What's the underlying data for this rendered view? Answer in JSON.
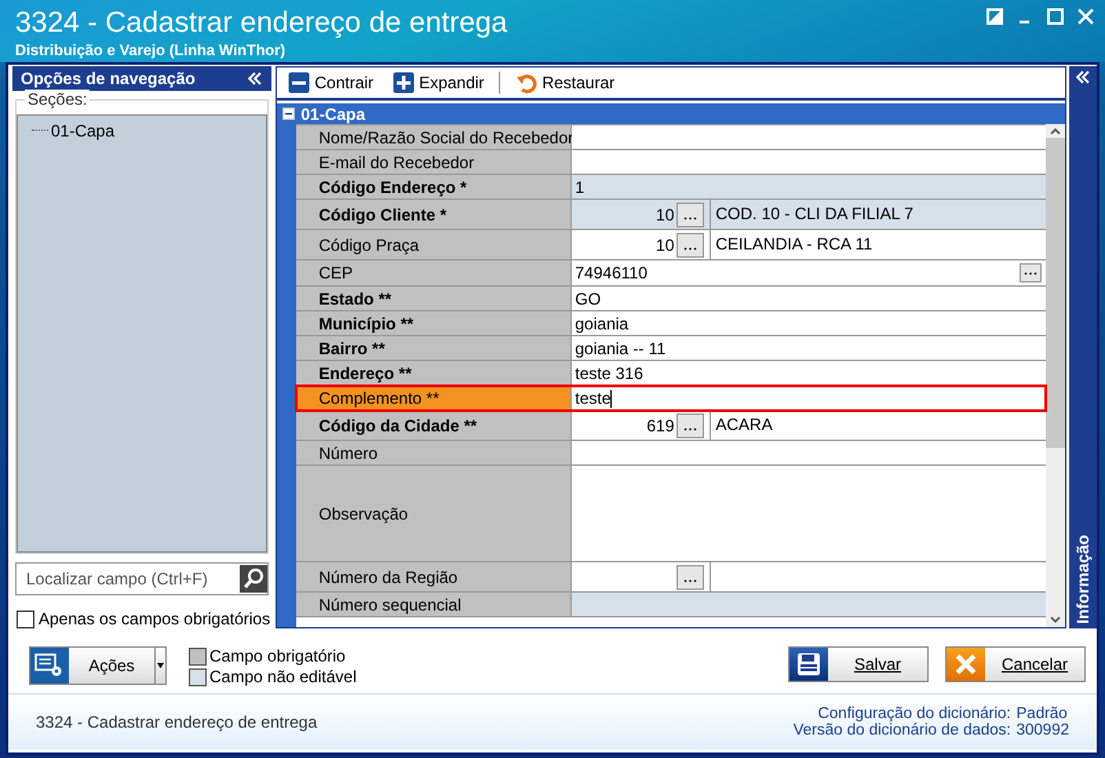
{
  "window": {
    "title": "3324 - Cadastrar endereço de entrega",
    "subtitle": "Distribuição e Varejo (Linha WinThor)"
  },
  "navigation": {
    "title": "Opções de navegação",
    "sections_label": "Seções:",
    "tree": [
      {
        "label": "01-Capa"
      }
    ],
    "search": {
      "placeholder": "Localizar campo (Ctrl+F)"
    },
    "required_only": {
      "label": "Apenas os campos obrigatórios",
      "checked": false
    }
  },
  "toolbar": [
    {
      "label": "Contrair",
      "kind": "collapse"
    },
    {
      "label": "Expandir",
      "kind": "expand"
    },
    {
      "label": "Restaurar",
      "kind": "restore"
    }
  ],
  "section": {
    "title": "01-Capa",
    "expanded": true
  },
  "rows": [
    {
      "label": "Nome/Razão Social do Recebedor",
      "bold": false,
      "kind": "text",
      "value": "",
      "readonly": false,
      "selected": false
    },
    {
      "label": "E-mail do Recebedor",
      "bold": false,
      "kind": "text",
      "value": "",
      "readonly": false,
      "selected": false
    },
    {
      "label": "Código Endereço *",
      "bold": true,
      "kind": "text",
      "value": "1",
      "readonly": true,
      "selected": false
    },
    {
      "label": "Código Cliente  *",
      "bold": true,
      "kind": "lookup",
      "value": "10",
      "description": "COD. 10 - CLI DA FILIAL 7",
      "readonly": true,
      "selected": false
    },
    {
      "label": "Código Praça",
      "bold": false,
      "kind": "lookup",
      "value": "10",
      "description": "CEILANDIA - RCA 11",
      "readonly": false,
      "selected": false
    },
    {
      "label": "CEP",
      "bold": false,
      "kind": "search",
      "value": "74946110",
      "readonly": false,
      "selected": false
    },
    {
      "label": "Estado **",
      "bold": true,
      "kind": "text",
      "value": "GO",
      "readonly": false,
      "selected": false
    },
    {
      "label": "Município **",
      "bold": true,
      "kind": "text",
      "value": "goiania",
      "readonly": false,
      "selected": false
    },
    {
      "label": "Bairro **",
      "bold": true,
      "kind": "text",
      "value": "goiania -- 11",
      "readonly": false,
      "selected": false
    },
    {
      "label": "Endereço **",
      "bold": true,
      "kind": "text",
      "value": "teste 316",
      "readonly": false,
      "selected": false
    },
    {
      "label": "Complemento **",
      "bold": false,
      "kind": "text",
      "value": "teste",
      "readonly": false,
      "selected": true
    },
    {
      "label": "Código da Cidade **",
      "bold": true,
      "kind": "lookup",
      "value": "619",
      "description": "ACARA",
      "readonly": false,
      "selected": false
    },
    {
      "label": "Número",
      "bold": false,
      "kind": "text",
      "value": "",
      "readonly": false,
      "selected": false
    },
    {
      "label": "Observação",
      "bold": false,
      "kind": "memo",
      "value": "",
      "readonly": false,
      "selected": false
    },
    {
      "label": "Número da Região",
      "bold": false,
      "kind": "lookup",
      "value": "",
      "description": "",
      "readonly": false,
      "selected": false
    },
    {
      "label": "Número sequencial",
      "bold": false,
      "kind": "text",
      "value": "",
      "readonly": true,
      "selected": false
    }
  ],
  "info_panel": {
    "title": "Informação"
  },
  "actions_button": {
    "label": "Ações"
  },
  "legend": [
    {
      "label": "Campo obrigatório",
      "color": "#c0c0c0"
    },
    {
      "label": "Campo não editável",
      "color": "#d6e0ea"
    }
  ],
  "buttons": [
    {
      "label": "Salvar",
      "kind": "save"
    },
    {
      "label": "Cancelar",
      "kind": "cancel"
    }
  ],
  "status_bar": {
    "text": "3324 - Cadastrar endereço de entrega",
    "config_label": "Configuração do dicionário:",
    "config_value": "Padrão",
    "version_label": "Versão do dicionário de dados:",
    "version_value": "300992"
  }
}
